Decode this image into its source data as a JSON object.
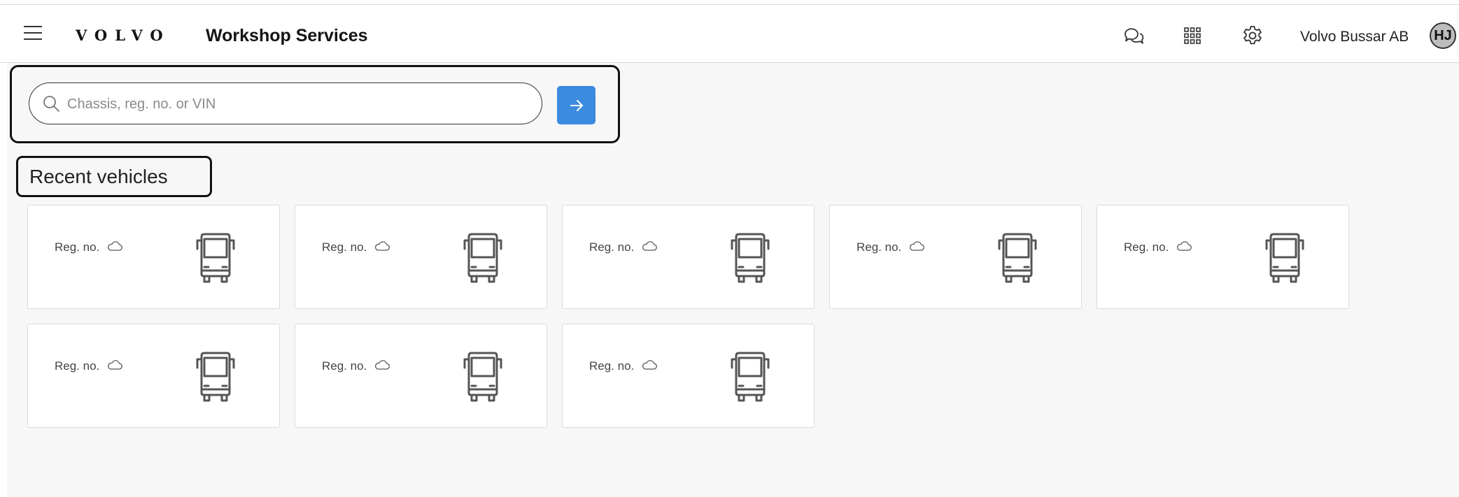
{
  "header": {
    "brand": "VOLVO",
    "app_title": "Workshop Services",
    "company": "Volvo Bussar AB",
    "user_initials": "HJ",
    "icons": [
      "menu-icon",
      "chat-icon",
      "apps-grid-icon",
      "settings-gear-icon"
    ]
  },
  "search": {
    "placeholder": "Chassis, reg. no. or VIN",
    "value": "",
    "submit_icon": "arrow-right-icon",
    "accent_color": "#3b8be0"
  },
  "recent": {
    "title": "Recent vehicles",
    "cards": [
      {
        "reg_label": "Reg. no.",
        "status_icon": "cloud-icon",
        "vehicle_icon": "bus-icon"
      },
      {
        "reg_label": "Reg. no.",
        "status_icon": "cloud-icon",
        "vehicle_icon": "bus-icon"
      },
      {
        "reg_label": "Reg. no.",
        "status_icon": "cloud-icon",
        "vehicle_icon": "bus-icon"
      },
      {
        "reg_label": "Reg. no.",
        "status_icon": "cloud-icon",
        "vehicle_icon": "bus-icon"
      },
      {
        "reg_label": "Reg. no.",
        "status_icon": "cloud-icon",
        "vehicle_icon": "bus-icon"
      },
      {
        "reg_label": "Reg. no.",
        "status_icon": "cloud-icon",
        "vehicle_icon": "bus-icon"
      },
      {
        "reg_label": "Reg. no.",
        "status_icon": "cloud-icon",
        "vehicle_icon": "bus-icon"
      },
      {
        "reg_label": "Reg. no.",
        "status_icon": "cloud-icon",
        "vehicle_icon": "bus-icon"
      }
    ]
  }
}
